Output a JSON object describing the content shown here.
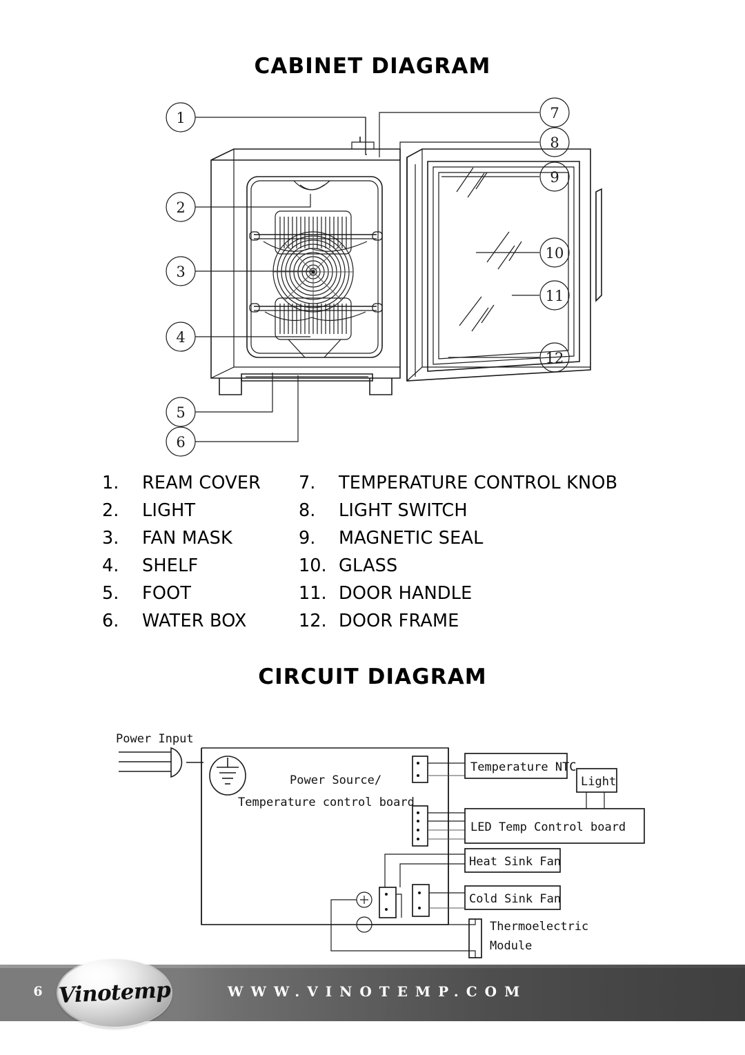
{
  "page": {
    "cabinet_heading": "CABINET DIAGRAM",
    "circuit_heading": "CIRCUIT DIAGRAM",
    "page_number": "6"
  },
  "cabinet_diagram": {
    "callouts": [
      "1",
      "2",
      "3",
      "4",
      "5",
      "6",
      "7",
      "8",
      "9",
      "10",
      "11",
      "12"
    ]
  },
  "parts_list": {
    "left": [
      {
        "number": "1.",
        "label": "REAM COVER"
      },
      {
        "number": "2.",
        "label": "LIGHT"
      },
      {
        "number": "3.",
        "label": "FAN MASK"
      },
      {
        "number": "4.",
        "label": "SHELF"
      },
      {
        "number": "5.",
        "label": "FOOT"
      },
      {
        "number": "6.",
        "label": "WATER BOX"
      }
    ],
    "right": [
      {
        "number": "7.",
        "label": "TEMPERATURE CONTROL KNOB"
      },
      {
        "number": "8.",
        "label": "LIGHT SWITCH"
      },
      {
        "number": "9.",
        "label": "MAGNETIC SEAL"
      },
      {
        "number": "10.",
        "label": "GLASS"
      },
      {
        "number": "11.",
        "label": "DOOR HANDLE"
      },
      {
        "number": "12.",
        "label": "DOOR FRAME"
      }
    ]
  },
  "circuit_diagram": {
    "power_input_label": "Power Input",
    "power_source_line1": "Power Source/",
    "power_source_line2": "Temperature control board",
    "temperature_ntc": "Temperature NTC",
    "light": "Light",
    "led_temp_control_board": "LED Temp Control board",
    "heat_sink_fan": "Heat Sink Fan",
    "cold_sink_fan": "Cold Sink Fan",
    "thermoelectric_line1": "Thermoelectric",
    "thermoelectric_line2": "Module",
    "plus_symbol": "+",
    "minus_symbol": "−"
  },
  "footer": {
    "brand": "Vinotemp",
    "url": "WWW.VINOTEMP.COM",
    "background_start": "#7c7c7c",
    "background_end": "#3f3f3f",
    "text_color": "#ffffff"
  }
}
